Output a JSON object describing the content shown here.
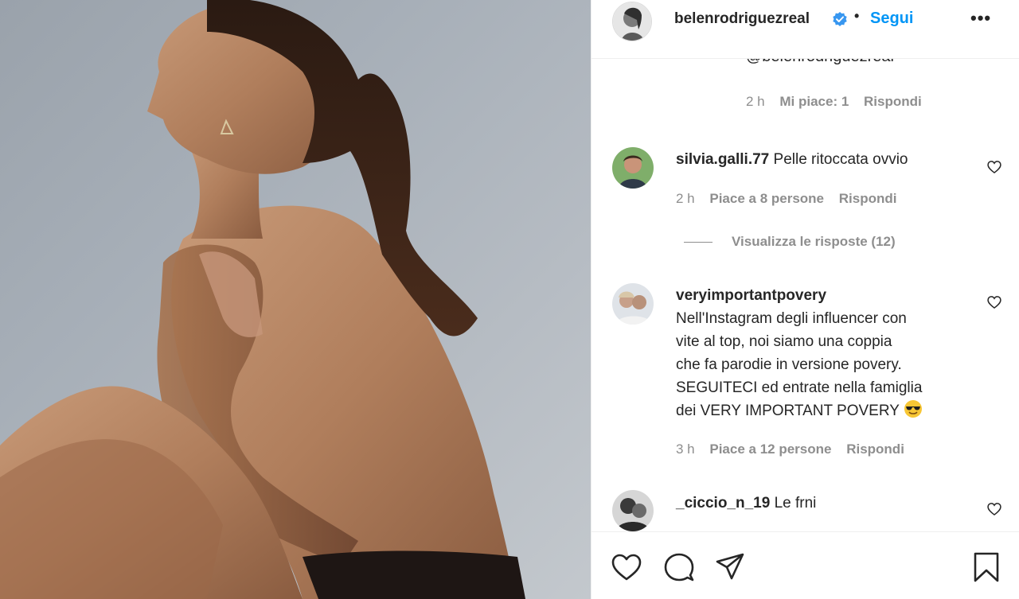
{
  "post": {
    "image_alt": "",
    "author": {
      "username": "belenrodriguezreal",
      "verified": true,
      "follow_label": "Segui",
      "separator": "•",
      "more_label": "•••"
    }
  },
  "comments": {
    "partial_text": "@belenrodriguezreal",
    "partial_meta": {
      "time": "2 h",
      "likes": "Mi piace: 1",
      "reply": "Rispondi"
    },
    "items": [
      {
        "username": "silvia.galli.77",
        "text": "Pelle ritoccata ovvio",
        "time": "2 h",
        "likes": "Piace a 8 persone",
        "reply": "Rispondi",
        "view_replies": "Visualizza le risposte (12)"
      },
      {
        "username": "veryimportantpovery",
        "text_lines": [
          "Nell'Instagram degli influencer con",
          "vite al top, noi siamo una coppia",
          "che fa parodie in versione povery.",
          "SEGUITECI ed entrate nella famiglia",
          "dei VERY IMPORTANT POVERY"
        ],
        "emoji": "smiling-face-with-sunglasses",
        "time": "3 h",
        "likes": "Piace a 12 persone",
        "reply": "Rispondi"
      },
      {
        "username": "_ciccio_n_19",
        "text": "Le frni"
      }
    ]
  },
  "colors": {
    "link_blue": "#0095f6",
    "text": "#262626",
    "muted": "#8e8e8e",
    "border": "#efefef"
  }
}
